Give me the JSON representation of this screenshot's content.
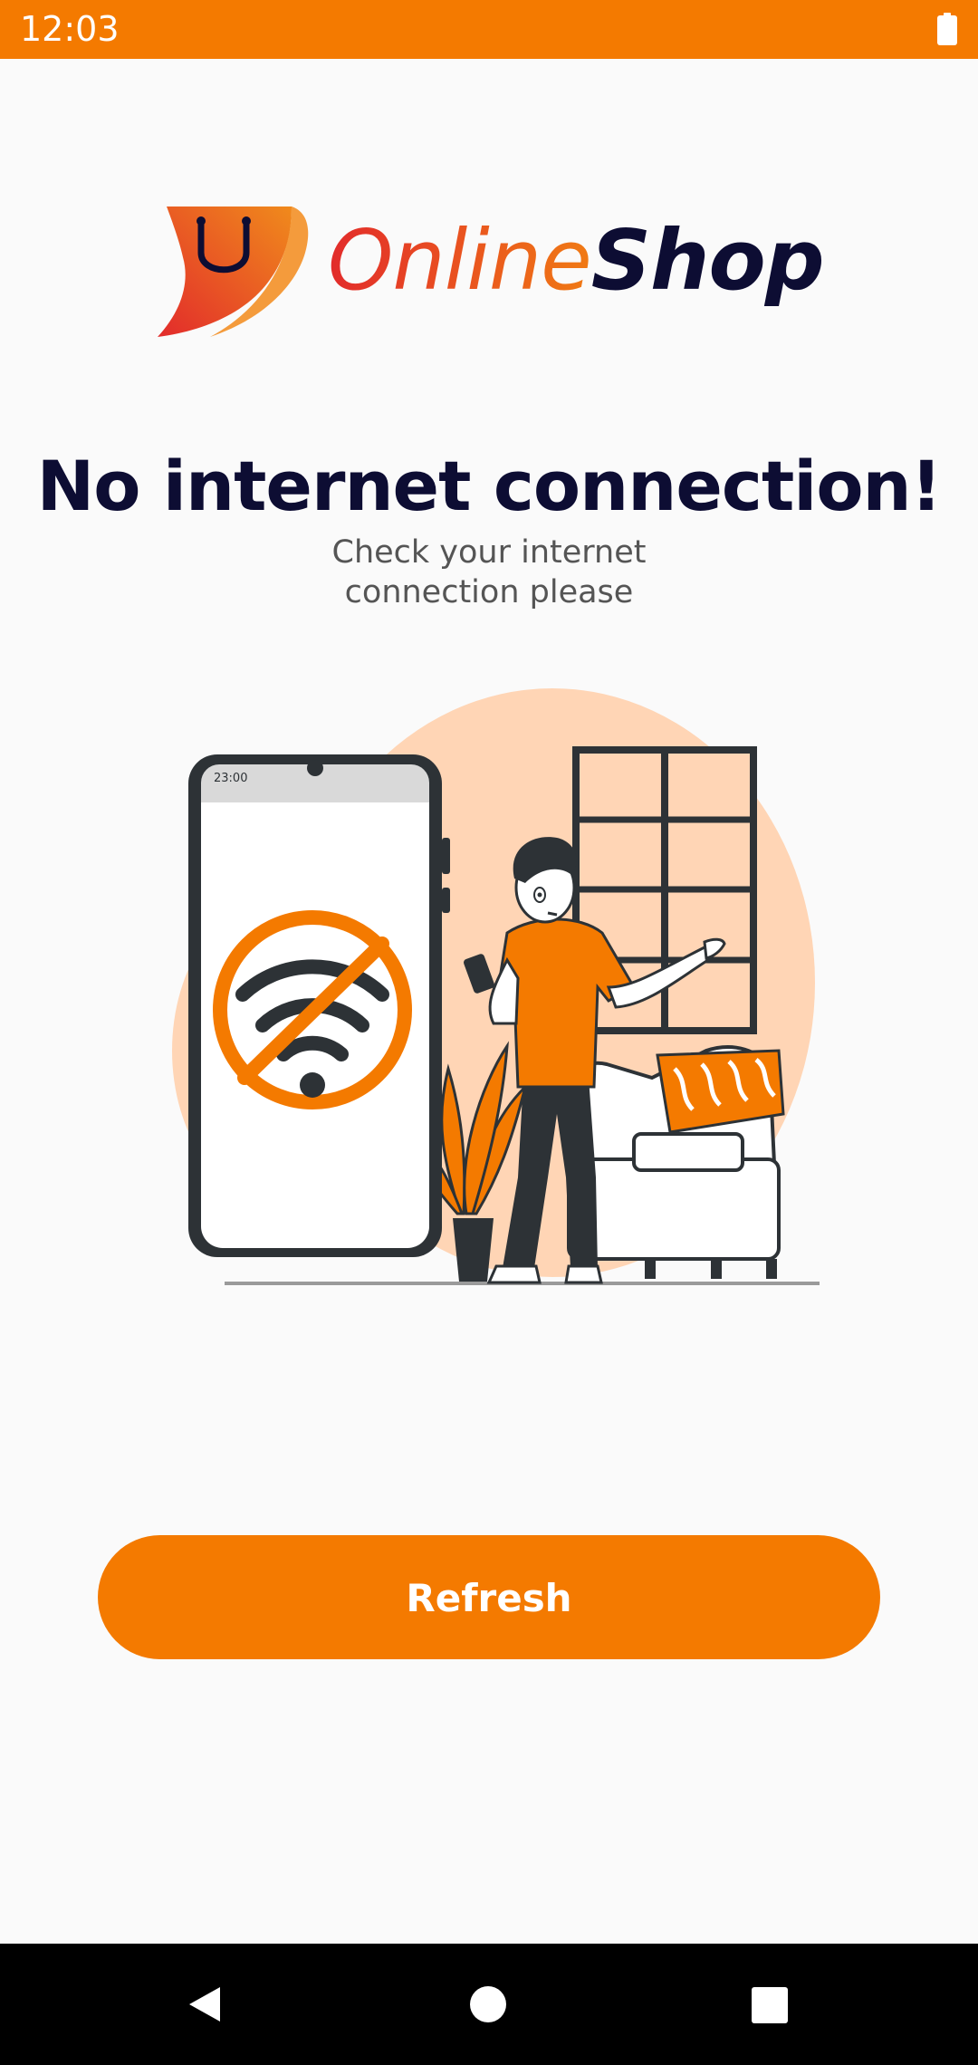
{
  "status_bar": {
    "time": "12:03",
    "battery_icon": "battery-full-icon",
    "color": "#f47a00"
  },
  "logo": {
    "text_part1": "Online",
    "text_part2": "Shop",
    "mark_icon": "shopping-bag-icon"
  },
  "message": {
    "title": "No internet connection!",
    "subtitle_line1": "Check your internet",
    "subtitle_line2": "connection please"
  },
  "illustration": {
    "phone_time": "23:00",
    "icon": "no-wifi-icon"
  },
  "actions": {
    "refresh_label": "Refresh"
  },
  "nav_bar": {
    "back_icon": "back-triangle-icon",
    "home_icon": "home-circle-icon",
    "recents_icon": "recents-square-icon"
  },
  "colors": {
    "accent": "#f47a00",
    "title": "#0d0d33",
    "subtitle": "#555555",
    "background": "#fafafa",
    "illustration_bg": "#ffd5b5"
  }
}
